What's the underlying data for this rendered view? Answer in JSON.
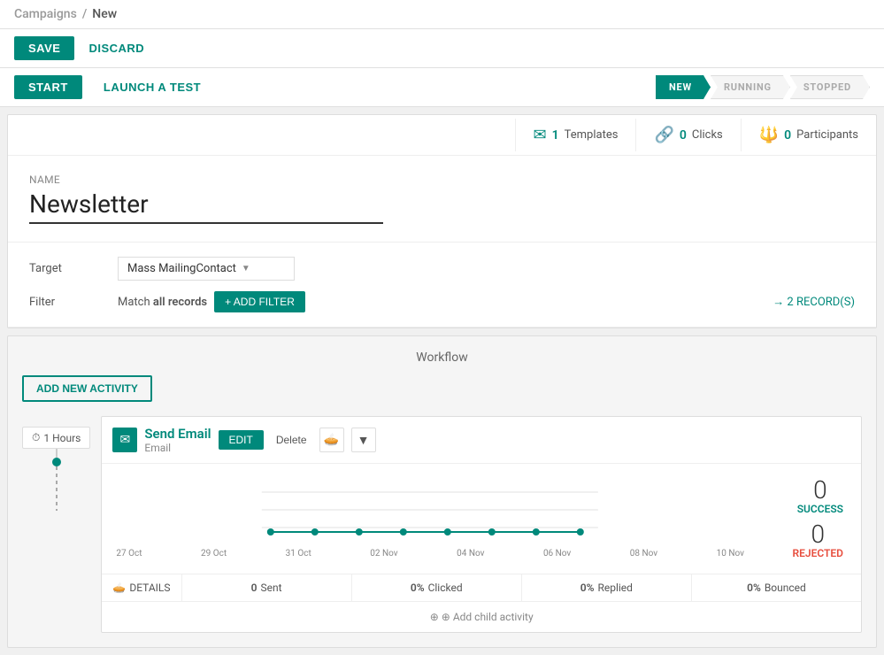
{
  "breadcrumb": {
    "parent": "Campaigns",
    "separator": "/",
    "current": "New"
  },
  "toolbar": {
    "save_label": "SAVE",
    "discard_label": "DISCARD"
  },
  "workflow_bar": {
    "start_label": "START",
    "launch_test_label": "LAUNCH A TEST"
  },
  "pipeline": {
    "steps": [
      {
        "label": "NEW",
        "active": true
      },
      {
        "label": "RUNNING",
        "active": false
      },
      {
        "label": "STOPPED",
        "active": false
      }
    ]
  },
  "stats": {
    "templates": {
      "count": "1",
      "label": "Templates"
    },
    "clicks": {
      "count": "0",
      "label": "Clicks"
    },
    "participants": {
      "count": "0",
      "label": "Participants"
    }
  },
  "form": {
    "name_label": "Name",
    "name_value": "Newsletter",
    "target_label": "Target",
    "target_value": "Mass MailingContact",
    "filter_label": "Filter",
    "filter_match_text": "Match",
    "filter_match_qualifier": "all records",
    "add_filter_label": "+ ADD FILTER",
    "records_count": "→  2 RECORD(S)"
  },
  "workflow": {
    "title": "Workflow",
    "add_activity_label": "ADD NEW ACTIVITY",
    "time_badge": "⏱ 1 Hours",
    "activity": {
      "icon": "✉",
      "title": "Send Email",
      "subtitle": "Email",
      "edit_label": "EDIT",
      "delete_label": "Delete",
      "success_count": "0",
      "success_label": "SUCCESS",
      "rejected_count": "0",
      "rejected_label": "REJECTED",
      "footer": {
        "details_label": "DETAILS",
        "sent_count": "0",
        "sent_label": "Sent",
        "clicked_pct": "0%",
        "clicked_label": "Clicked",
        "replied_pct": "0%",
        "replied_label": "Replied",
        "bounced_pct": "0%",
        "bounced_label": "Bounced"
      },
      "add_child_label": "⊕ Add child activity",
      "chart_labels": [
        "27 Oct",
        "29 Oct",
        "31 Oct",
        "02 Nov",
        "04 Nov",
        "06 Nov",
        "08 Nov",
        "10 Nov"
      ]
    }
  }
}
